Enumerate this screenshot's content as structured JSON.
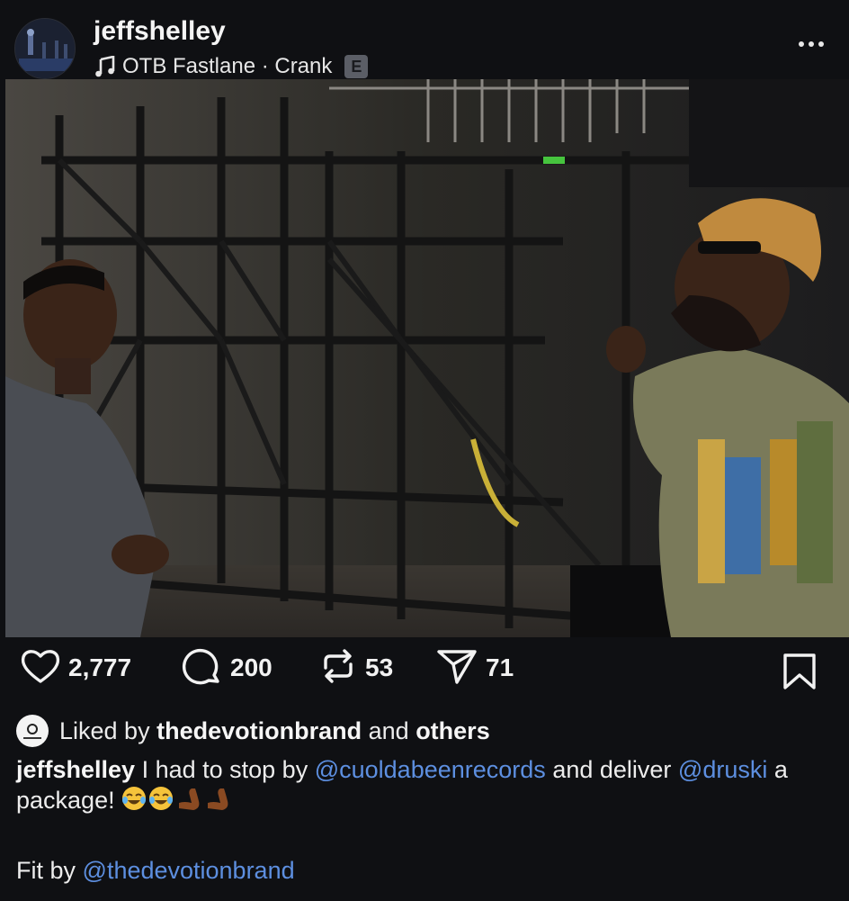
{
  "post": {
    "username": "jeffshelley",
    "audio": {
      "track": "OTB Fastlane · Crank",
      "explicit_badge": "E"
    }
  },
  "actions": {
    "likes": "2,777",
    "comments": "200",
    "reposts": "53",
    "shares": "71"
  },
  "liked_by": {
    "prefix": "Liked by",
    "user": "thedevotionbrand",
    "connector": "and",
    "others": "others"
  },
  "caption": {
    "author": "jeffshelley",
    "text1": "I had to stop by",
    "mention1": "@cuoldabeenrecords",
    "text2": "and deliver",
    "mention2": "@druski",
    "text3": "a package!",
    "emojis": [
      "face-with-tears-of-joy",
      "face-with-tears-of-joy",
      "flexed-biceps",
      "flexed-biceps"
    ]
  },
  "fit_by": {
    "prefix": "Fit by",
    "mention": "@thedevotionbrand"
  },
  "colors": {
    "background": "#0f1013",
    "mention": "#5d8fe0",
    "text": "#ededed"
  }
}
